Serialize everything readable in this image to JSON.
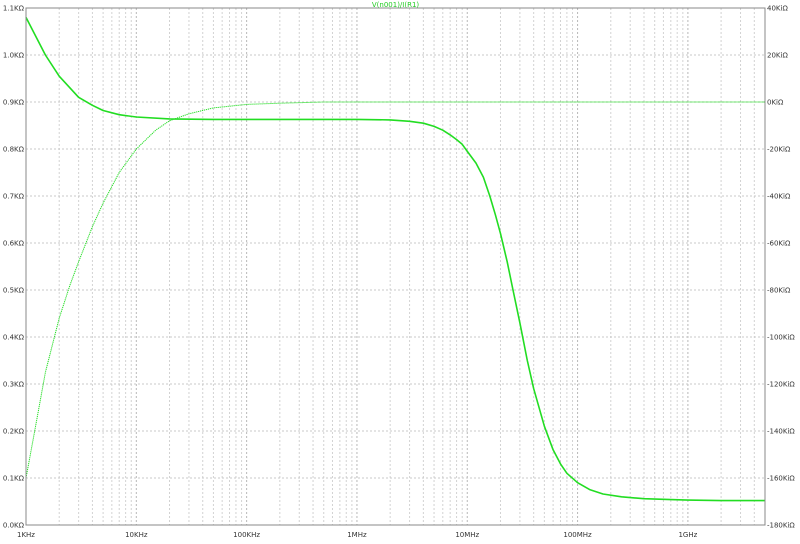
{
  "chart_data": {
    "type": "line",
    "title": "V(n001)/I(R1)",
    "title_color": "#22cc22",
    "x_scale": "log",
    "xlim": [
      1000,
      5000000000
    ],
    "x_ticks": [
      {
        "value": 1000,
        "label": "1KHz"
      },
      {
        "value": 10000,
        "label": "10KHz"
      },
      {
        "value": 100000,
        "label": "100KHz"
      },
      {
        "value": 1000000,
        "label": "1MHz"
      },
      {
        "value": 10000000,
        "label": "10MHz"
      },
      {
        "value": 100000000,
        "label": "100MHz"
      },
      {
        "value": 1000000000,
        "label": "1GHz"
      }
    ],
    "y_left": {
      "lim": [
        0,
        1.1
      ],
      "ticks": [
        {
          "value": 0.0,
          "label": "0.0KΩ"
        },
        {
          "value": 0.1,
          "label": "0.1KΩ"
        },
        {
          "value": 0.2,
          "label": "0.2KΩ"
        },
        {
          "value": 0.3,
          "label": "0.3KΩ"
        },
        {
          "value": 0.4,
          "label": "0.4KΩ"
        },
        {
          "value": 0.5,
          "label": "0.5KΩ"
        },
        {
          "value": 0.6,
          "label": "0.6KΩ"
        },
        {
          "value": 0.7,
          "label": "0.7KΩ"
        },
        {
          "value": 0.8,
          "label": "0.8KΩ"
        },
        {
          "value": 0.9,
          "label": "0.9KΩ"
        },
        {
          "value": 1.0,
          "label": "1.0KΩ"
        },
        {
          "value": 1.1,
          "label": "1.1KΩ"
        }
      ]
    },
    "y_right": {
      "lim": [
        -180,
        40
      ],
      "ticks": [
        {
          "value": 40,
          "label": "40KiΩ"
        },
        {
          "value": 20,
          "label": "20KiΩ"
        },
        {
          "value": 0,
          "label": "0KiΩ"
        },
        {
          "value": -20,
          "label": "-20KiΩ"
        },
        {
          "value": -40,
          "label": "-40KiΩ"
        },
        {
          "value": -60,
          "label": "-60KiΩ"
        },
        {
          "value": -80,
          "label": "-80KiΩ"
        },
        {
          "value": -100,
          "label": "-100KiΩ"
        },
        {
          "value": -120,
          "label": "-120KiΩ"
        },
        {
          "value": -140,
          "label": "-140KiΩ"
        },
        {
          "value": -160,
          "label": "-160KiΩ"
        },
        {
          "value": -180,
          "label": "-180KiΩ"
        }
      ]
    },
    "grid": true,
    "series": [
      {
        "axis": "left",
        "style": "solid",
        "color": "#22dd22",
        "points": [
          [
            1000,
            1.08
          ],
          [
            1500,
            1.0
          ],
          [
            2000,
            0.955
          ],
          [
            3000,
            0.91
          ],
          [
            4000,
            0.893
          ],
          [
            5000,
            0.882
          ],
          [
            7000,
            0.873
          ],
          [
            10000,
            0.868
          ],
          [
            20000,
            0.864
          ],
          [
            50000,
            0.863
          ],
          [
            100000,
            0.863
          ],
          [
            1000000,
            0.863
          ],
          [
            2000000,
            0.862
          ],
          [
            3000000,
            0.859
          ],
          [
            4000000,
            0.855
          ],
          [
            5000000,
            0.848
          ],
          [
            6000000,
            0.84
          ],
          [
            7000000,
            0.83
          ],
          [
            8000000,
            0.82
          ],
          [
            9000000,
            0.81
          ],
          [
            10000000,
            0.795
          ],
          [
            12000000,
            0.77
          ],
          [
            14000000,
            0.74
          ],
          [
            16000000,
            0.7
          ],
          [
            18000000,
            0.66
          ],
          [
            20000000,
            0.62
          ],
          [
            23000000,
            0.56
          ],
          [
            26000000,
            0.5
          ],
          [
            30000000,
            0.43
          ],
          [
            35000000,
            0.35
          ],
          [
            40000000,
            0.29
          ],
          [
            50000000,
            0.21
          ],
          [
            60000000,
            0.16
          ],
          [
            70000000,
            0.13
          ],
          [
            80000000,
            0.11
          ],
          [
            100000000,
            0.09
          ],
          [
            130000000,
            0.075
          ],
          [
            170000000,
            0.066
          ],
          [
            250000000,
            0.06
          ],
          [
            400000000,
            0.056
          ],
          [
            700000000,
            0.054
          ],
          [
            1000000000,
            0.053
          ],
          [
            2000000000,
            0.052
          ],
          [
            5000000000,
            0.052
          ]
        ]
      },
      {
        "axis": "right",
        "style": "dotted",
        "color": "#22dd22",
        "points": [
          [
            1000,
            -160
          ],
          [
            1200,
            -140
          ],
          [
            1500,
            -115
          ],
          [
            2000,
            -92
          ],
          [
            2500,
            -78
          ],
          [
            3000,
            -68
          ],
          [
            4000,
            -53
          ],
          [
            5000,
            -43
          ],
          [
            7000,
            -30
          ],
          [
            10000,
            -20
          ],
          [
            15000,
            -12
          ],
          [
            20000,
            -8
          ],
          [
            30000,
            -5
          ],
          [
            50000,
            -2.5
          ],
          [
            100000,
            -1
          ],
          [
            200000,
            -0.5
          ],
          [
            500000,
            0
          ],
          [
            1000000,
            0
          ],
          [
            10000000,
            0
          ],
          [
            100000000,
            0
          ],
          [
            1000000000,
            0
          ],
          [
            5000000000,
            0
          ]
        ]
      }
    ]
  }
}
